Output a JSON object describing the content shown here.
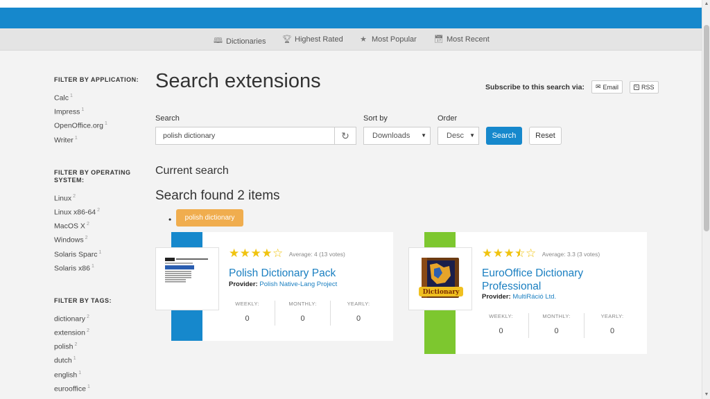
{
  "nav": {
    "items": [
      {
        "label": "Dictionaries",
        "icon": "book-icon"
      },
      {
        "label": "Highest Rated",
        "icon": "trophy-icon"
      },
      {
        "label": "Most Popular",
        "icon": "star-icon"
      },
      {
        "label": "Most Recent",
        "icon": "calendar-icon"
      }
    ]
  },
  "sidebar": {
    "application": {
      "title": "FILTER BY APPLICATION:",
      "items": [
        {
          "label": "Calc",
          "count": "1"
        },
        {
          "label": "Impress",
          "count": "1"
        },
        {
          "label": "OpenOffice.org",
          "count": "1"
        },
        {
          "label": "Writer",
          "count": "1"
        }
      ]
    },
    "os": {
      "title": "FILTER BY OPERATING SYSTEM:",
      "items": [
        {
          "label": "Linux",
          "count": "2"
        },
        {
          "label": "Linux x86-64",
          "count": "2"
        },
        {
          "label": "MacOS X",
          "count": "2"
        },
        {
          "label": "Windows",
          "count": "2"
        },
        {
          "label": "Solaris Sparc",
          "count": "1"
        },
        {
          "label": "Solaris x86",
          "count": "1"
        }
      ]
    },
    "tags": {
      "title": "FILTER BY TAGS:",
      "items": [
        {
          "label": "dictionary",
          "count": "2"
        },
        {
          "label": "extension",
          "count": "2"
        },
        {
          "label": "polish",
          "count": "2"
        },
        {
          "label": "dutch",
          "count": "1"
        },
        {
          "label": "english",
          "count": "1"
        },
        {
          "label": "eurooffice",
          "count": "1"
        }
      ]
    }
  },
  "main": {
    "title": "Search extensions",
    "subscribe_label": "Subscribe to this search via:",
    "email_label": "Email",
    "rss_label": "RSS",
    "search_label": "Search",
    "search_value": "polish dictionary",
    "sort_label": "Sort by",
    "sort_value": "Downloads",
    "order_label": "Order",
    "order_value": "Desc",
    "search_button": "Search",
    "reset_button": "Reset",
    "current_search_heading": "Current search",
    "results_heading": "Search found 2 items",
    "active_tag": "polish dictionary"
  },
  "results": [
    {
      "rating": 4,
      "average": "Average: 4 (13 votes)",
      "title": "Polish Dictionary Pack",
      "provider_label": "Provider:",
      "provider": "Polish Native-Lang Project",
      "accent": "#1688cc",
      "stats": [
        {
          "label": "WEEKLY:",
          "value": "0"
        },
        {
          "label": "MONTHLY:",
          "value": "0"
        },
        {
          "label": "YEARLY:",
          "value": "0"
        }
      ]
    },
    {
      "rating": 3.5,
      "average": "Average: 3.3 (3 votes)",
      "title": "EuroOffice Dictionary Professional",
      "provider_label": "Provider:",
      "provider": "MultiRáció Ltd.",
      "accent": "#7dc72f",
      "stats": [
        {
          "label": "WEEKLY:",
          "value": "0"
        },
        {
          "label": "MONTHLY:",
          "value": "0"
        },
        {
          "label": "YEARLY:",
          "value": "0"
        }
      ]
    }
  ]
}
